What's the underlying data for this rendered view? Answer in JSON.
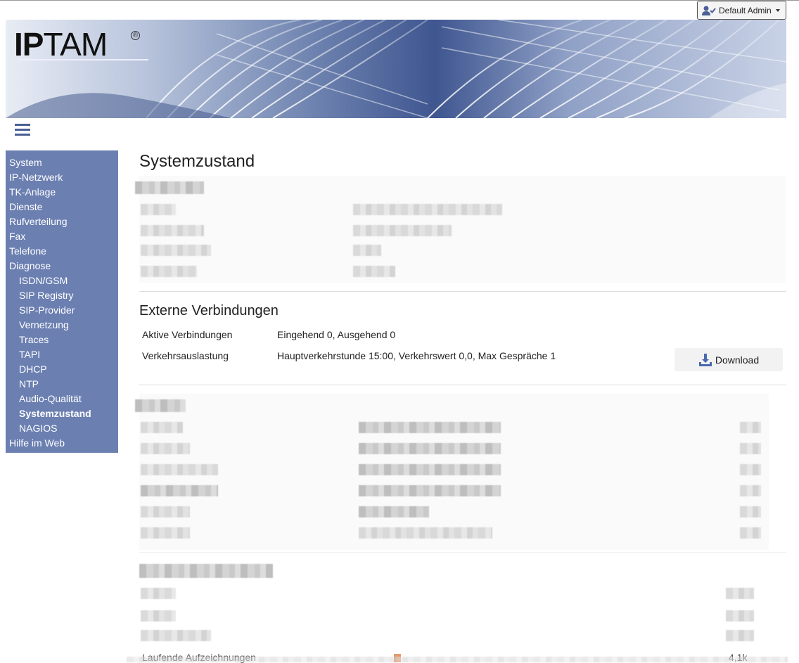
{
  "user_menu": {
    "label": "Default Admin"
  },
  "logo": {
    "text_bold": "IP",
    "text_light": "TAM",
    "reg": "®"
  },
  "sidebar": {
    "items": [
      {
        "label": "System",
        "sub": false
      },
      {
        "label": "IP-Netzwerk",
        "sub": false
      },
      {
        "label": "TK-Anlage",
        "sub": false
      },
      {
        "label": "Dienste",
        "sub": false
      },
      {
        "label": "Rufverteilung",
        "sub": false
      },
      {
        "label": "Fax",
        "sub": false
      },
      {
        "label": "Telefone",
        "sub": false
      },
      {
        "label": "Diagnose",
        "sub": false
      },
      {
        "label": "ISDN/GSM",
        "sub": true
      },
      {
        "label": "SIP Registry",
        "sub": true
      },
      {
        "label": "SIP-Provider",
        "sub": true
      },
      {
        "label": "Vernetzung",
        "sub": true
      },
      {
        "label": "Traces",
        "sub": true
      },
      {
        "label": "TAPI",
        "sub": true
      },
      {
        "label": "DHCP",
        "sub": true
      },
      {
        "label": "NTP",
        "sub": true
      },
      {
        "label": "Audio-Qualität",
        "sub": true
      },
      {
        "label": "Systemzustand",
        "sub": true,
        "active": true
      },
      {
        "label": "NAGIOS",
        "sub": true
      },
      {
        "label": "Hilfe im Web",
        "sub": false
      }
    ]
  },
  "main": {
    "title": "Systemzustand",
    "external": {
      "heading": "Externe Verbindungen",
      "rows": [
        {
          "label": "Aktive Verbindungen",
          "value": "Eingehend 0, Ausgehend 0"
        },
        {
          "label": "Verkehrsauslastung",
          "value": "Hauptverkehrstunde 15:00, Verkehrswert 0,0, Max Gespräche 1"
        }
      ],
      "download_label": "Download"
    },
    "partial_row": {
      "label": "Laufende Aufzeichnungen",
      "value": "4,1k"
    }
  },
  "colors": {
    "sidebar_bg": "#6b7fb1",
    "accent": "#4a5f95"
  }
}
